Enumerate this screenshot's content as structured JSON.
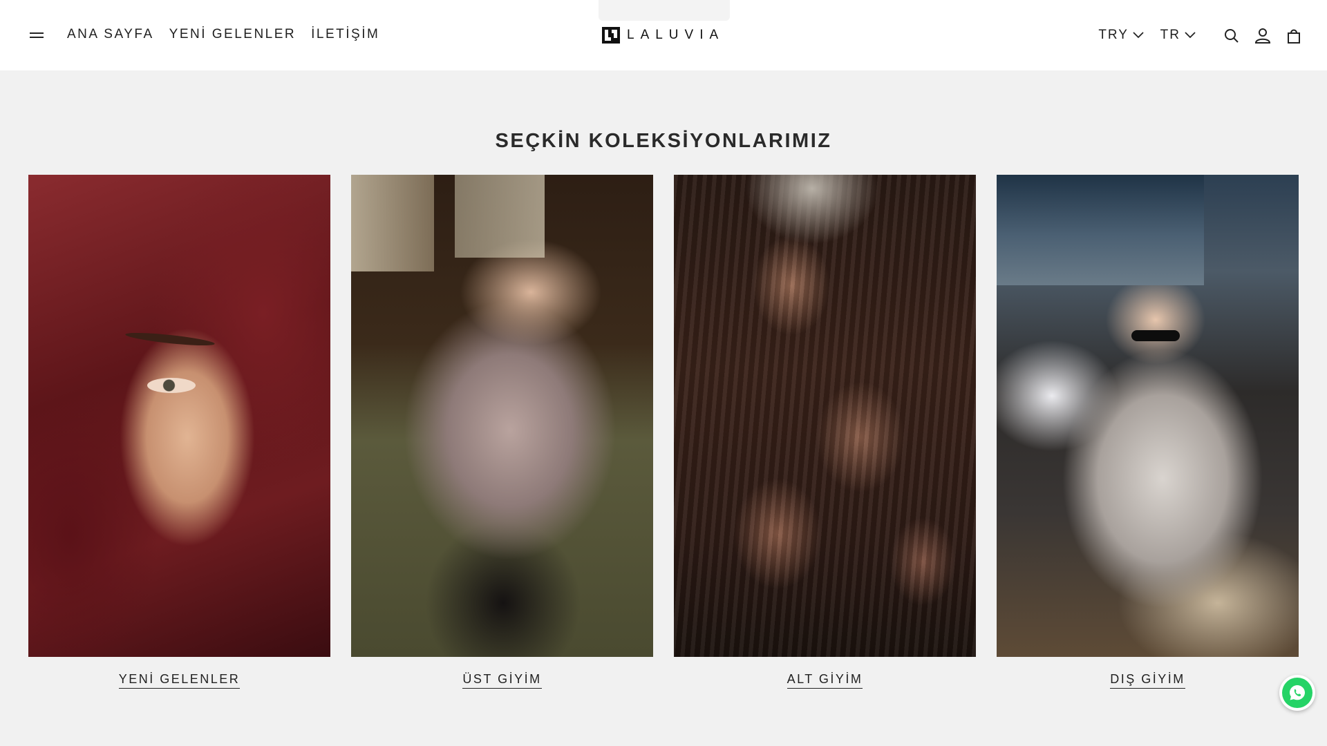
{
  "header": {
    "nav": [
      {
        "label": "ANA SAYFA"
      },
      {
        "label": "YENİ GELENLER"
      },
      {
        "label": "İLETİŞİM"
      }
    ],
    "logo_text": "LALUVIA",
    "currency": "TRY",
    "language": "TR",
    "icons": [
      "menu-icon",
      "search-icon",
      "account-icon",
      "cart-icon",
      "chevron-down-icon"
    ]
  },
  "section": {
    "title": "SEÇKİN KOLEKSİYONLARIMIZ",
    "cards": [
      {
        "label": "YENİ GELENLER"
      },
      {
        "label": "ÜST GİYİM"
      },
      {
        "label": "ALT GİYİM"
      },
      {
        "label": "DIŞ GİYİM"
      }
    ]
  },
  "colors": {
    "header_bg": "#ffffff",
    "page_bg": "#f1f1f1",
    "text": "#1f1f1f",
    "whatsapp": "#25d366"
  }
}
